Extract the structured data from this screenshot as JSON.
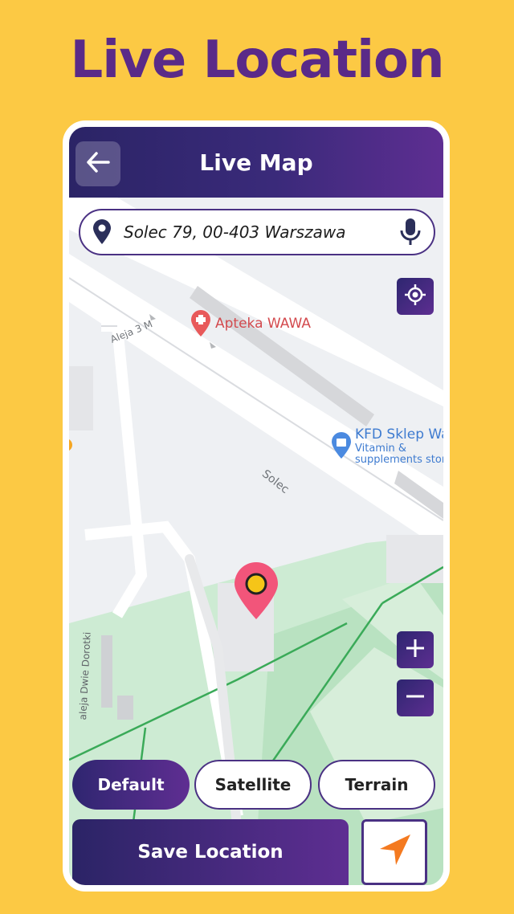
{
  "hero": {
    "title": "Live Location"
  },
  "appbar": {
    "title": "Live Map",
    "back_icon": "arrow-left-icon"
  },
  "search": {
    "value": "Solec 79, 00-403 Warszawa",
    "pin_icon": "location-pin-icon",
    "mic_icon": "microphone-icon"
  },
  "map": {
    "labels": {
      "apteka": "Apteka WAWA",
      "kfd_name": "KFD Sklep Wa",
      "kfd_sub1": "Vitamin &",
      "kfd_sub2": "supplements stor",
      "street_solec": "Solec",
      "street_aleja": "Aleja 3 M",
      "street_dwie": "aleja Dwie Dorotki"
    },
    "marker_icon": "map-marker-icon",
    "locate_icon": "crosshair-icon",
    "zoom_in_icon": "plus-icon",
    "zoom_out_icon": "minus-icon"
  },
  "map_types": {
    "options": [
      "Default",
      "Satellite",
      "Terrain"
    ],
    "selected": "Default"
  },
  "actions": {
    "save_label": "Save Location",
    "navigate_icon": "navigation-arrow-icon"
  },
  "colors": {
    "background": "#FCC944",
    "brand_dark": "#2B2466",
    "brand_purple": "#5E2E92",
    "marker": "#F2557A",
    "nav_arrow": "#F47A20"
  }
}
